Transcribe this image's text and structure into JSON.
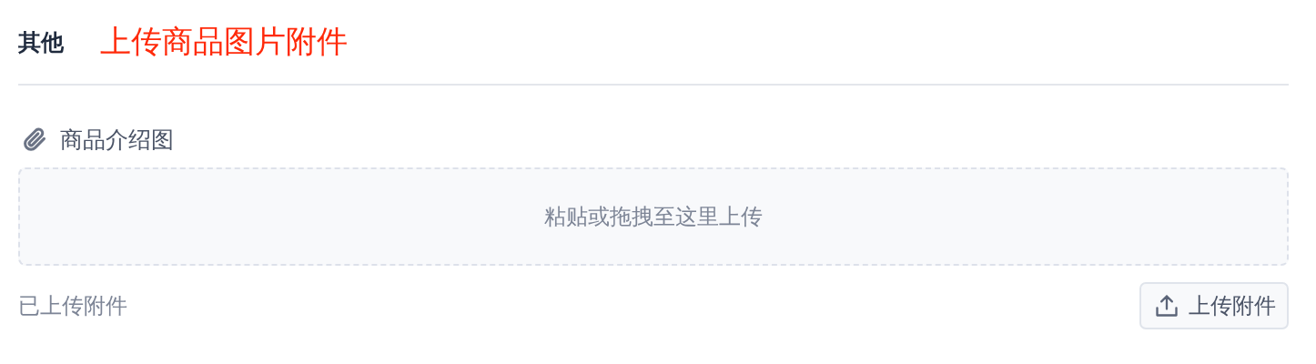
{
  "section": {
    "title": "其他",
    "annotation": "上传商品图片附件"
  },
  "attachment_group": {
    "label": "商品介绍图",
    "dropzone_text": "粘贴或拖拽至这里上传",
    "uploaded_label": "已上传附件",
    "upload_button": "上传附件"
  }
}
